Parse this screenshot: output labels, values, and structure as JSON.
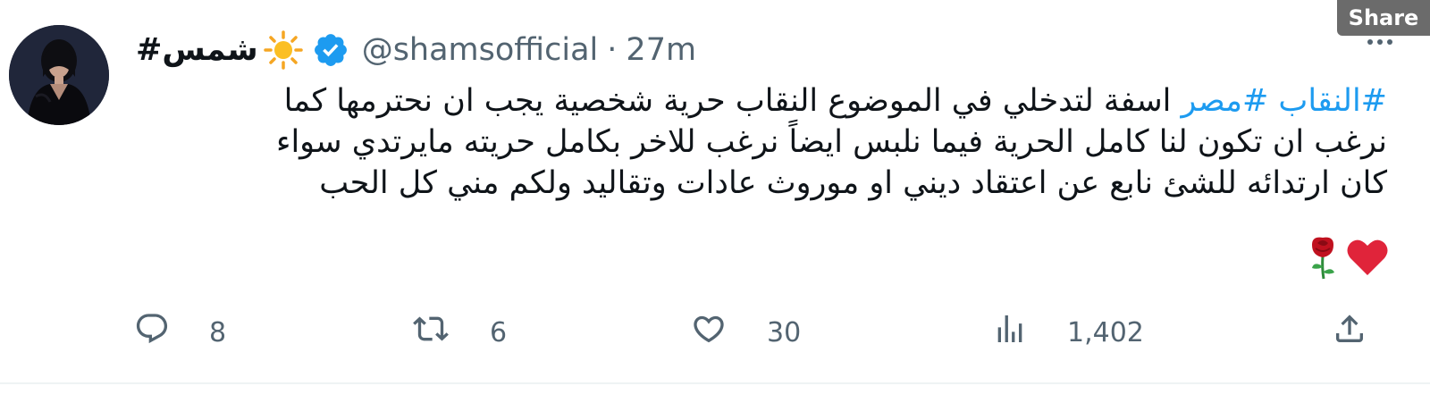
{
  "share_tag": "Share",
  "author": {
    "display_name": "شمس#",
    "emoji": "sun-icon",
    "verified": true,
    "handle": "@shamsofficial",
    "separator": "·",
    "time": "27m"
  },
  "body": {
    "line1_hashtags": "#النقاب #مصر",
    "line1_text": "  اسفة لتدخلي في الموضوع  النقاب حرية شخصية  يجب ان نحترمها  كما",
    "line2": "نرغب ان تكون لنا كامل الحرية فيما نلبس  ايضاً  نرغب للاخر بكامل حريته مايرتدي  سواء",
    "line3": "كان ارتدائه للشئ نابع عن اعتقاد ديني او  موروث  عادات وتقاليد  ولكم مني كل الحب",
    "emojis": [
      "heart-icon",
      "rose-icon"
    ]
  },
  "actions": {
    "reply_count": "8",
    "retweet_count": "6",
    "like_count": "30",
    "views_count": "1,402"
  },
  "colors": {
    "link": "#1d9bf0",
    "muted": "#536471",
    "verified": "#1d9bf0",
    "text": "#0f1419"
  }
}
